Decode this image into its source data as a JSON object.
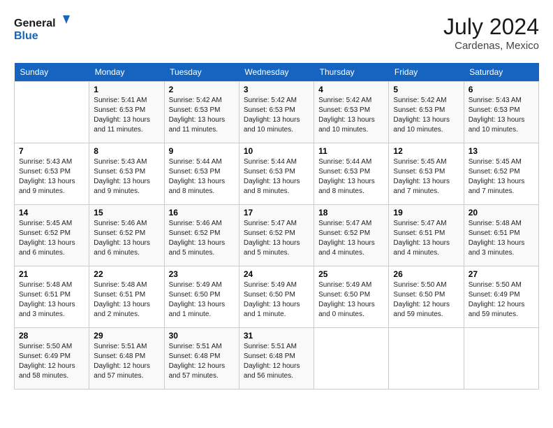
{
  "header": {
    "logo_line1": "General",
    "logo_line2": "Blue",
    "month_year": "July 2024",
    "location": "Cardenas, Mexico"
  },
  "weekdays": [
    "Sunday",
    "Monday",
    "Tuesday",
    "Wednesday",
    "Thursday",
    "Friday",
    "Saturday"
  ],
  "weeks": [
    [
      {
        "day": "",
        "info": ""
      },
      {
        "day": "1",
        "info": "Sunrise: 5:41 AM\nSunset: 6:53 PM\nDaylight: 13 hours\nand 11 minutes."
      },
      {
        "day": "2",
        "info": "Sunrise: 5:42 AM\nSunset: 6:53 PM\nDaylight: 13 hours\nand 11 minutes."
      },
      {
        "day": "3",
        "info": "Sunrise: 5:42 AM\nSunset: 6:53 PM\nDaylight: 13 hours\nand 10 minutes."
      },
      {
        "day": "4",
        "info": "Sunrise: 5:42 AM\nSunset: 6:53 PM\nDaylight: 13 hours\nand 10 minutes."
      },
      {
        "day": "5",
        "info": "Sunrise: 5:42 AM\nSunset: 6:53 PM\nDaylight: 13 hours\nand 10 minutes."
      },
      {
        "day": "6",
        "info": "Sunrise: 5:43 AM\nSunset: 6:53 PM\nDaylight: 13 hours\nand 10 minutes."
      }
    ],
    [
      {
        "day": "7",
        "info": "Sunrise: 5:43 AM\nSunset: 6:53 PM\nDaylight: 13 hours\nand 9 minutes."
      },
      {
        "day": "8",
        "info": "Sunrise: 5:43 AM\nSunset: 6:53 PM\nDaylight: 13 hours\nand 9 minutes."
      },
      {
        "day": "9",
        "info": "Sunrise: 5:44 AM\nSunset: 6:53 PM\nDaylight: 13 hours\nand 8 minutes."
      },
      {
        "day": "10",
        "info": "Sunrise: 5:44 AM\nSunset: 6:53 PM\nDaylight: 13 hours\nand 8 minutes."
      },
      {
        "day": "11",
        "info": "Sunrise: 5:44 AM\nSunset: 6:53 PM\nDaylight: 13 hours\nand 8 minutes."
      },
      {
        "day": "12",
        "info": "Sunrise: 5:45 AM\nSunset: 6:53 PM\nDaylight: 13 hours\nand 7 minutes."
      },
      {
        "day": "13",
        "info": "Sunrise: 5:45 AM\nSunset: 6:52 PM\nDaylight: 13 hours\nand 7 minutes."
      }
    ],
    [
      {
        "day": "14",
        "info": "Sunrise: 5:45 AM\nSunset: 6:52 PM\nDaylight: 13 hours\nand 6 minutes."
      },
      {
        "day": "15",
        "info": "Sunrise: 5:46 AM\nSunset: 6:52 PM\nDaylight: 13 hours\nand 6 minutes."
      },
      {
        "day": "16",
        "info": "Sunrise: 5:46 AM\nSunset: 6:52 PM\nDaylight: 13 hours\nand 5 minutes."
      },
      {
        "day": "17",
        "info": "Sunrise: 5:47 AM\nSunset: 6:52 PM\nDaylight: 13 hours\nand 5 minutes."
      },
      {
        "day": "18",
        "info": "Sunrise: 5:47 AM\nSunset: 6:52 PM\nDaylight: 13 hours\nand 4 minutes."
      },
      {
        "day": "19",
        "info": "Sunrise: 5:47 AM\nSunset: 6:51 PM\nDaylight: 13 hours\nand 4 minutes."
      },
      {
        "day": "20",
        "info": "Sunrise: 5:48 AM\nSunset: 6:51 PM\nDaylight: 13 hours\nand 3 minutes."
      }
    ],
    [
      {
        "day": "21",
        "info": "Sunrise: 5:48 AM\nSunset: 6:51 PM\nDaylight: 13 hours\nand 3 minutes."
      },
      {
        "day": "22",
        "info": "Sunrise: 5:48 AM\nSunset: 6:51 PM\nDaylight: 13 hours\nand 2 minutes."
      },
      {
        "day": "23",
        "info": "Sunrise: 5:49 AM\nSunset: 6:50 PM\nDaylight: 13 hours\nand 1 minute."
      },
      {
        "day": "24",
        "info": "Sunrise: 5:49 AM\nSunset: 6:50 PM\nDaylight: 13 hours\nand 1 minute."
      },
      {
        "day": "25",
        "info": "Sunrise: 5:49 AM\nSunset: 6:50 PM\nDaylight: 13 hours\nand 0 minutes."
      },
      {
        "day": "26",
        "info": "Sunrise: 5:50 AM\nSunset: 6:50 PM\nDaylight: 12 hours\nand 59 minutes."
      },
      {
        "day": "27",
        "info": "Sunrise: 5:50 AM\nSunset: 6:49 PM\nDaylight: 12 hours\nand 59 minutes."
      }
    ],
    [
      {
        "day": "28",
        "info": "Sunrise: 5:50 AM\nSunset: 6:49 PM\nDaylight: 12 hours\nand 58 minutes."
      },
      {
        "day": "29",
        "info": "Sunrise: 5:51 AM\nSunset: 6:48 PM\nDaylight: 12 hours\nand 57 minutes."
      },
      {
        "day": "30",
        "info": "Sunrise: 5:51 AM\nSunset: 6:48 PM\nDaylight: 12 hours\nand 57 minutes."
      },
      {
        "day": "31",
        "info": "Sunrise: 5:51 AM\nSunset: 6:48 PM\nDaylight: 12 hours\nand 56 minutes."
      },
      {
        "day": "",
        "info": ""
      },
      {
        "day": "",
        "info": ""
      },
      {
        "day": "",
        "info": ""
      }
    ]
  ]
}
